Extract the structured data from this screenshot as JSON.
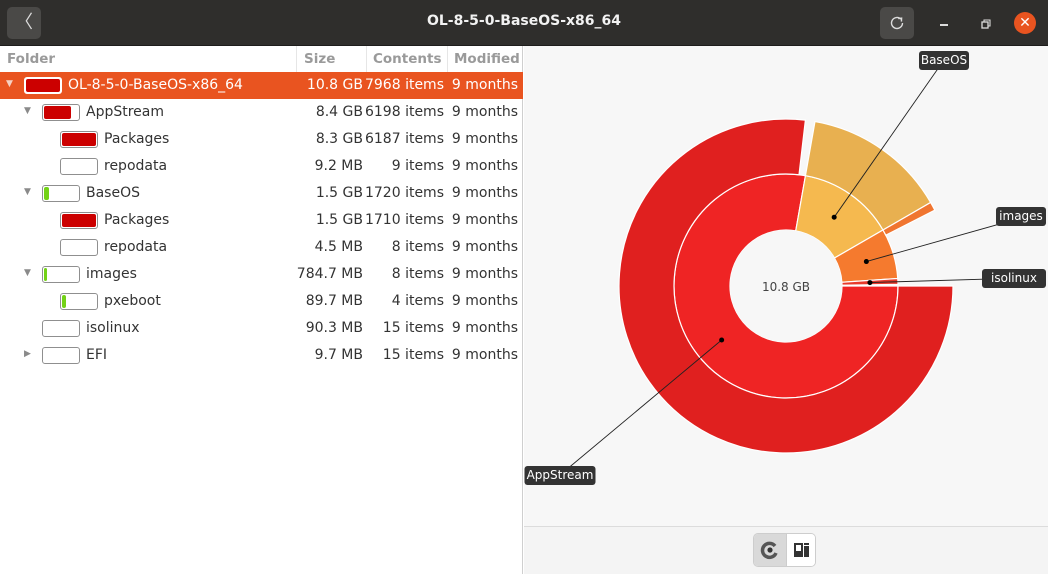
{
  "window": {
    "title": "OL-8-5-0-BaseOS-x86_64",
    "back_icon": "chevron-left-icon",
    "reload_icon": "reload-icon",
    "minimize_icon": "minimize-icon",
    "maximize_icon": "restore-icon",
    "close_icon": "close-icon"
  },
  "colors": {
    "accent": "#e95420",
    "bar_red": "#cc0000",
    "bar_green": "#73d216"
  },
  "table": {
    "columns": [
      "Folder",
      "Size",
      "Contents",
      "Modified"
    ],
    "rows": [
      {
        "name": "OL-8-5-0-BaseOS-x86_64",
        "size": "10.8 GB",
        "contents": "7968 items",
        "modified": "9 months",
        "level": 0,
        "expander": "expanded",
        "fill": 1.0,
        "fill_color": "#cc0000",
        "selected": true
      },
      {
        "name": "AppStream",
        "size": "8.4 GB",
        "contents": "6198 items",
        "modified": "9 months",
        "level": 1,
        "expander": "expanded",
        "fill": 0.78,
        "fill_color": "#cc0000",
        "selected": false
      },
      {
        "name": "Packages",
        "size": "8.3 GB",
        "contents": "6187 items",
        "modified": "9 months",
        "level": 2,
        "expander": "none",
        "fill": 0.99,
        "fill_color": "#cc0000",
        "selected": false
      },
      {
        "name": "repodata",
        "size": "9.2 MB",
        "contents": "9 items",
        "modified": "9 months",
        "level": 2,
        "expander": "none",
        "fill": 0.0,
        "fill_color": "#cc0000",
        "selected": false
      },
      {
        "name": "BaseOS",
        "size": "1.5 GB",
        "contents": "1720 items",
        "modified": "9 months",
        "level": 1,
        "expander": "expanded",
        "fill": 0.14,
        "fill_color": "#73d216",
        "selected": false
      },
      {
        "name": "Packages",
        "size": "1.5 GB",
        "contents": "1710 items",
        "modified": "9 months",
        "level": 2,
        "expander": "none",
        "fill": 0.99,
        "fill_color": "#cc0000",
        "selected": false
      },
      {
        "name": "repodata",
        "size": "4.5 MB",
        "contents": "8 items",
        "modified": "9 months",
        "level": 2,
        "expander": "none",
        "fill": 0.0,
        "fill_color": "#cc0000",
        "selected": false
      },
      {
        "name": "images",
        "size": "784.7 MB",
        "contents": "8 items",
        "modified": "9 months",
        "level": 1,
        "expander": "expanded",
        "fill": 0.07,
        "fill_color": "#73d216",
        "selected": false
      },
      {
        "name": "pxeboot",
        "size": "89.7 MB",
        "contents": "4 items",
        "modified": "9 months",
        "level": 2,
        "expander": "none",
        "fill": 0.11,
        "fill_color": "#73d216",
        "selected": false
      },
      {
        "name": "isolinux",
        "size": "90.3 MB",
        "contents": "15 items",
        "modified": "9 months",
        "level": 1,
        "expander": "none",
        "fill": 0.0,
        "fill_color": "#73d216",
        "selected": false
      },
      {
        "name": "EFI",
        "size": "9.7 MB",
        "contents": "15 items",
        "modified": "9 months",
        "level": 1,
        "expander": "collapsed",
        "fill": 0.0,
        "fill_color": "#73d216",
        "selected": false
      }
    ]
  },
  "chart_data": {
    "type": "pie",
    "subtype": "sunburst",
    "center_label": "10.8 GB",
    "total_gb": 10.8,
    "rings": [
      {
        "level": 1,
        "segments": [
          {
            "name": "AppStream",
            "value_gb": 8.4,
            "color": "#ef2424",
            "label_shown": true
          },
          {
            "name": "BaseOS",
            "value_gb": 1.5,
            "color": "#f5b94f",
            "label_shown": true
          },
          {
            "name": "images",
            "value_gb": 0.7847,
            "color": "#f57a2e",
            "label_shown": true
          },
          {
            "name": "isolinux",
            "value_gb": 0.0903,
            "color": "#e83a2c",
            "label_shown": true
          },
          {
            "name": "EFI",
            "value_gb": 0.0097,
            "color": "#f7f7f7",
            "label_shown": false
          }
        ]
      },
      {
        "level": 2,
        "segments": [
          {
            "parent": "AppStream",
            "name": "Packages",
            "value_gb": 8.3,
            "color": "#e0201f"
          },
          {
            "parent": "BaseOS",
            "name": "Packages",
            "value_gb": 1.5,
            "color": "#e8b050"
          },
          {
            "parent": "images",
            "name": "pxeboot",
            "value_gb": 0.0897,
            "color": "#f07530"
          }
        ]
      }
    ],
    "legend": "callout-labels"
  },
  "view_toggle": {
    "rings_icon": "rings-chart-icon",
    "treemap_icon": "treemap-chart-icon",
    "active": "rings"
  }
}
